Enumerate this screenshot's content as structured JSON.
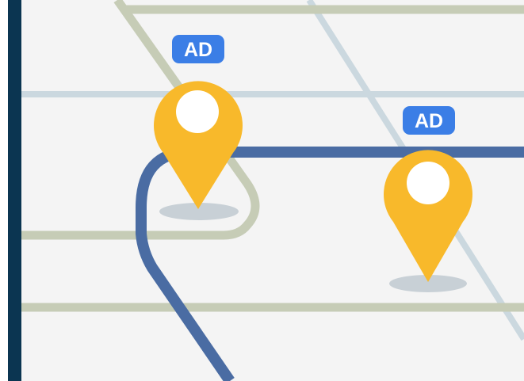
{
  "map": {
    "colors": {
      "background": "#f4f4f4",
      "sidebar": "#0b3551",
      "minor_road": "#c6ccb6",
      "light_road": "#cbd8df",
      "route": "#4a6ca3",
      "pin": "#f8b92b",
      "pin_dot": "#ffffff",
      "pin_shadow": "#c8d0d6",
      "badge": "#3b7ee6"
    },
    "markers": [
      {
        "badge_label": "AD",
        "icon": "map-pin-icon"
      },
      {
        "badge_label": "AD",
        "icon": "map-pin-icon"
      }
    ]
  }
}
